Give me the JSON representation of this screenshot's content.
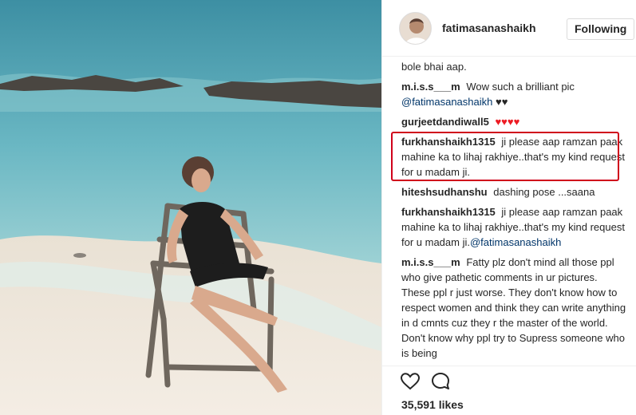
{
  "post": {
    "username": "fatimasanashaikh",
    "follow_label": "Following",
    "likes": "35,591 likes"
  },
  "comments": [
    {
      "user": "",
      "text": "bole bhai aap."
    },
    {
      "user": "m.i.s.s___m",
      "text": "Wow such a brilliant pic",
      "mention": "@fatimasanashaikh",
      "emoji": "♥♥"
    },
    {
      "user": "gurjeetdandiwall5",
      "hearts": "♥♥♥♥"
    },
    {
      "user": "furkhanshaikh1315",
      "text": "ji please aap ramzan paak mahine ka to lihaj rakhiye..that's my kind request for u madam ji.",
      "highlighted": true
    },
    {
      "user": "hiteshsudhanshu",
      "text": "dashing pose ...saana"
    },
    {
      "user": "furkhanshaikh1315",
      "text": "ji please aap ramzan paak mahine ka to lihaj rakhiye..that's my kind request for u madam ji.",
      "mention": "@fatimasanashaikh"
    },
    {
      "user": "m.i.s.s___m",
      "text": "Fatty plz don't mind all those ppl who give pathetic comments in ur pictures. These ppl r just worse. They don't know how to respect women and think they can write anything in d cmnts cuz they r the master of the world. Don't know why ppl try to Supress someone who is being"
    }
  ],
  "icons": [
    "heart-outline-icon",
    "comment-bubble-icon"
  ],
  "colors": {
    "highlight": "#d0021b",
    "mention": "#003569",
    "hearts": "#ed1c24"
  }
}
